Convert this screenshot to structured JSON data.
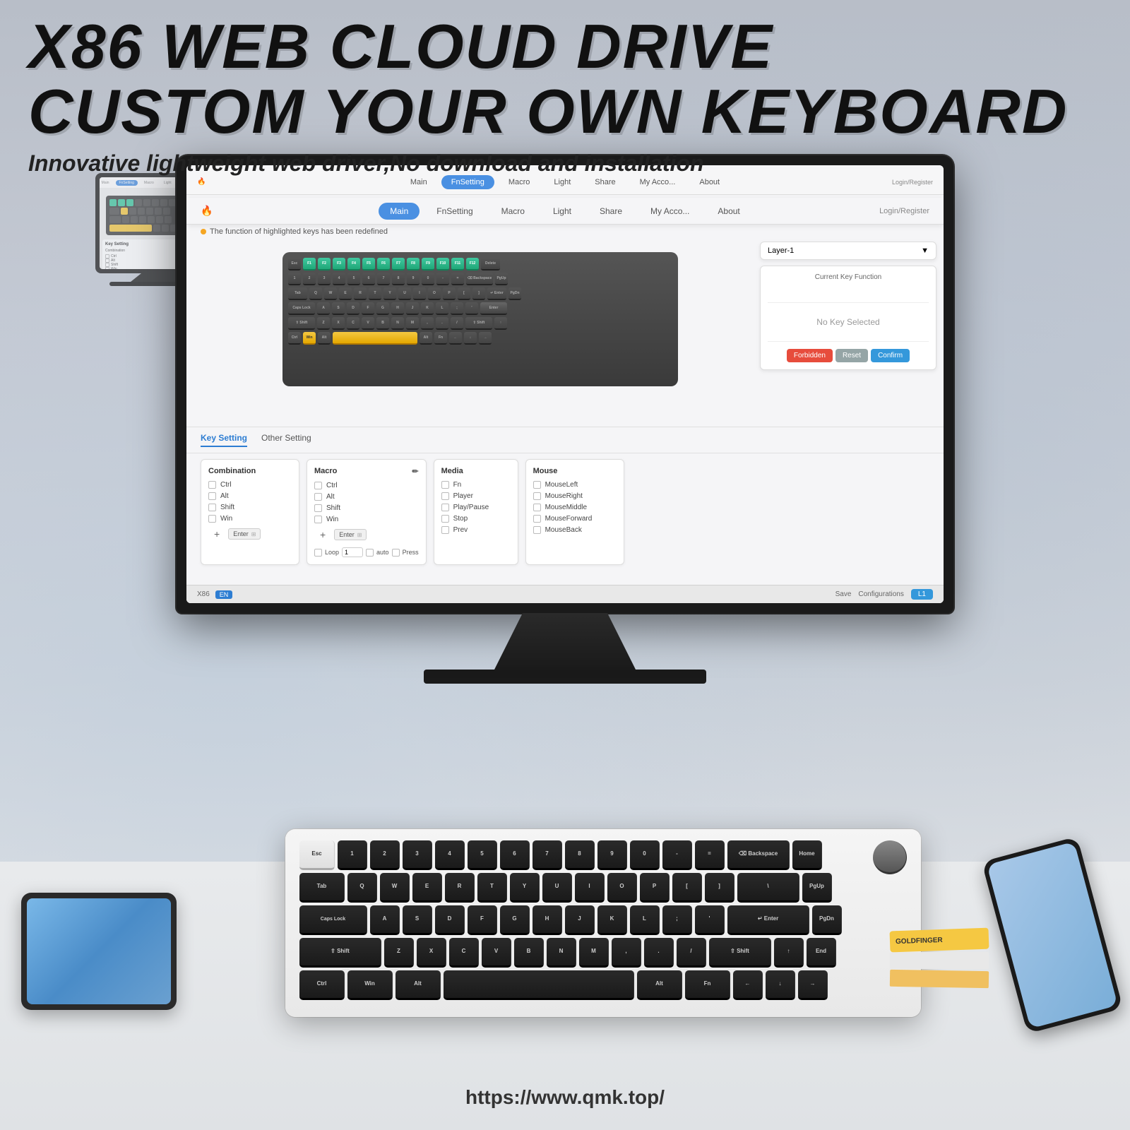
{
  "page": {
    "title": "X86 Web Cloud Drive - Custom Your Own Keyboard",
    "headline_line1": "X86 WEB CLOUD DRIVE",
    "headline_line2": "CUSTOM YOUR OWN KEYBOARD",
    "subtitle": "Innovative lightweight web driver,No download and installation",
    "url": "https://www.qmk.top/"
  },
  "nav": {
    "logo": "🔥",
    "tabs": [
      "Main",
      "FnSetting",
      "Macro",
      "Light",
      "Share",
      "My Acco...",
      "About"
    ],
    "active_tab": "Main",
    "login_label": "Login/Register"
  },
  "nav_bg": {
    "tabs": [
      "Main",
      "FnSetting",
      "Macro",
      "Light",
      "Share",
      "My Acco...",
      "About"
    ],
    "active_tab": "FnSetting"
  },
  "notice": {
    "text": "The function of highlighted keys has been redefined"
  },
  "layer_panel": {
    "layer_label": "Layer-1",
    "dropdown_arrow": "▼",
    "function_title": "Current Key Function",
    "function_value": "No Key Selected",
    "btn_forbidden": "Forbidden",
    "btn_reset": "Reset",
    "btn_confirm": "Confirm"
  },
  "key_setting": {
    "tab_key_setting": "Key Setting",
    "tab_other": "Other Setting",
    "active_tab": "Key Setting",
    "panels": {
      "combination": {
        "title": "Combination",
        "checkboxes": [
          "Ctrl",
          "Alt",
          "Shift",
          "Win"
        ],
        "plus_sign": "+",
        "enter_key": "Enter"
      },
      "macro": {
        "title": "Macro",
        "edit_icon": "✏️",
        "checkboxes": [
          "Ctrl",
          "Alt",
          "Shift",
          "Win"
        ],
        "plus_sign": "+",
        "enter_key": "Enter",
        "loop_label": "Loop",
        "auto_label": "auto",
        "press_label": "Press"
      },
      "media": {
        "title": "Media",
        "checkboxes": [
          "Fn",
          "Player",
          "Play/Pause",
          "Stop",
          "Prev"
        ]
      },
      "mouse": {
        "title": "Mouse",
        "checkboxes": [
          "MouseLeft",
          "MouseRight",
          "MouseMiddle",
          "MouseForward",
          "MouseBack"
        ]
      }
    }
  },
  "footer": {
    "brand": "X86",
    "badge": "EN",
    "save_label": "Save",
    "configurations_label": "Configurations",
    "layer_label": "L1"
  },
  "physical_keyboard": {
    "rows": [
      [
        "Esc",
        "1",
        "2",
        "3",
        "4",
        "5",
        "6",
        "7",
        "8",
        "9",
        "0",
        "-",
        "=",
        "Backspace",
        "Home"
      ],
      [
        "Tab",
        "Q",
        "W",
        "E",
        "R",
        "T",
        "Y",
        "U",
        "I",
        "O",
        "P",
        "[",
        "]",
        "\\",
        "PgUp"
      ],
      [
        "Caps Lock",
        "A",
        "S",
        "D",
        "F",
        "G",
        "H",
        "J",
        "K",
        "L",
        ";",
        "'",
        "Enter",
        "PgDn"
      ],
      [
        "Shift",
        "Z",
        "X",
        "C",
        "V",
        "B",
        "N",
        "M",
        ",",
        ".",
        "/",
        "Shift",
        "↑",
        "End"
      ],
      [
        "Ctrl",
        "Win",
        "Alt",
        "Space",
        "Alt",
        "Fn",
        "←",
        "↓",
        "→"
      ]
    ]
  },
  "colors": {
    "accent_blue": "#4a90e2",
    "accent_yellow": "#f5c842",
    "accent_teal": "#40c8a0",
    "nav_active": "#4a90e2",
    "forbidden_btn": "#e74c3c",
    "reset_btn": "#95a5a6",
    "confirm_btn": "#3498db"
  }
}
